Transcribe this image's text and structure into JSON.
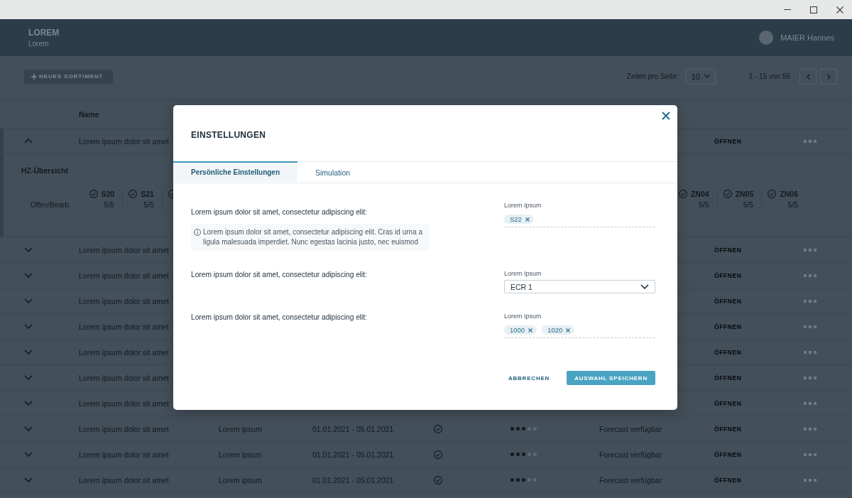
{
  "header": {
    "title": "LOREM",
    "subtitle": "Lorem",
    "user": "MAIER Hannes"
  },
  "toolbar": {
    "new_button": "NEUES SORTIMENT",
    "rows_per_page_label": "Zeilen pro Seite:",
    "rows_per_page": "10",
    "range": "1 - 15 von 55"
  },
  "table": {
    "columns": [
      {
        "label": "Name"
      }
    ],
    "rows": [
      {
        "kind": "covered",
        "expanded": true,
        "name": "Lorem ipsum dolor sit amet",
        "action": "ÖFFNEN",
        "details": {
          "title": "HZ-Übersicht",
          "row_label": "Offen/Bearb.",
          "tiles_left": [
            {
              "kind": "tile",
              "label": "S20",
              "count": "5/5"
            },
            {
              "kind": "tile",
              "label": "S21",
              "count": "5/5"
            },
            {
              "kind": "icon-only"
            }
          ],
          "tiles_right": [
            {
              "kind": "tile",
              "label": "ZN04",
              "count": "5/5"
            },
            {
              "kind": "tile",
              "label": "ZN05",
              "count": "5/5"
            },
            {
              "kind": "tile",
              "label": "ZN06",
              "count": "5/5"
            }
          ]
        }
      },
      {
        "kind": "covered",
        "expanded": false,
        "name": "Lorem ipsum dolor sit amet",
        "action": "ÖFFNEN"
      },
      {
        "kind": "covered",
        "expanded": false,
        "name": "Lorem ipsum dolor sit amet",
        "action": "ÖFFNEN"
      },
      {
        "kind": "covered",
        "expanded": false,
        "name": "Lorem ipsum dolor sit amet",
        "action": "ÖFFNEN"
      },
      {
        "kind": "covered",
        "expanded": false,
        "name": "Lorem ipsum dolor sit amet",
        "action": "ÖFFNEN"
      },
      {
        "kind": "covered",
        "expanded": false,
        "name": "Lorem ipsum dolor sit amet",
        "action": "ÖFFNEN"
      },
      {
        "kind": "covered",
        "expanded": false,
        "name": "Lorem ipsum dolor sit amet",
        "action": "ÖFFNEN"
      },
      {
        "kind": "covered",
        "expanded": false,
        "name": "Lorem ipsum dolor sit amet",
        "action": "ÖFFNEN"
      },
      {
        "kind": "full",
        "expanded": false,
        "name": "Lorem ipsum dolor sit amet",
        "column_2": "Lorem ipsum",
        "column_3": "01.01.2021 - 05.01.2021",
        "stars": 3,
        "column_6": "Forecast verfügbar",
        "action": "ÖFFNEN"
      },
      {
        "kind": "full",
        "expanded": false,
        "name": "Lorem ipsum dolor sit amet",
        "column_2": "Lorem ipsum",
        "column_3": "01.01.2021 - 05.01.2021",
        "stars": 3,
        "column_6": "Forecast verfügbar",
        "action": "ÖFFNEN"
      },
      {
        "kind": "full",
        "expanded": false,
        "name": "Lorem ipsum dolor sit amet",
        "column_2": "Lorem ipsum",
        "column_3": "01.01.2021 - 05.01.2021",
        "stars": 3,
        "column_6": "Forecast verfügbar",
        "action": "ÖFFNEN"
      }
    ]
  },
  "dialog": {
    "title": "EINSTELLUNGEN",
    "tabs": [
      {
        "label": "Persönliche Einstellungen",
        "selected": true
      },
      {
        "label": "Simulation",
        "selected": false
      }
    ],
    "settings": [
      {
        "question": "Lorem ipsum dolor sit amet, consectetur adipiscing elit:",
        "hint": "Lorem ipsum dolor sit amet, consectetur adipiscing elit. Cras id urna a ligula malesuada imperdiet. Nunc egestas lacinia justo, nec euismod",
        "field": {
          "kind": "chips",
          "label": "Lorem Ipsum",
          "chips": [
            "S22"
          ]
        }
      },
      {
        "question": "Lorem ipsum dolor sit amet, consectetur adipiscing elit:",
        "field": {
          "kind": "select",
          "label": "Lorem Ipsum",
          "value": "ECR 1"
        }
      },
      {
        "question": "Lorem ipsum dolor sit amet, consectetur adipiscing elit:",
        "field": {
          "kind": "chips",
          "label": "Lorem Ipsum",
          "chips": [
            "1000",
            "1020"
          ]
        }
      }
    ],
    "buttons": [
      {
        "kind": "text",
        "label": "ABBRECHEN"
      },
      {
        "kind": "primary",
        "label": "AUSWAHL SPEICHERN"
      }
    ]
  }
}
